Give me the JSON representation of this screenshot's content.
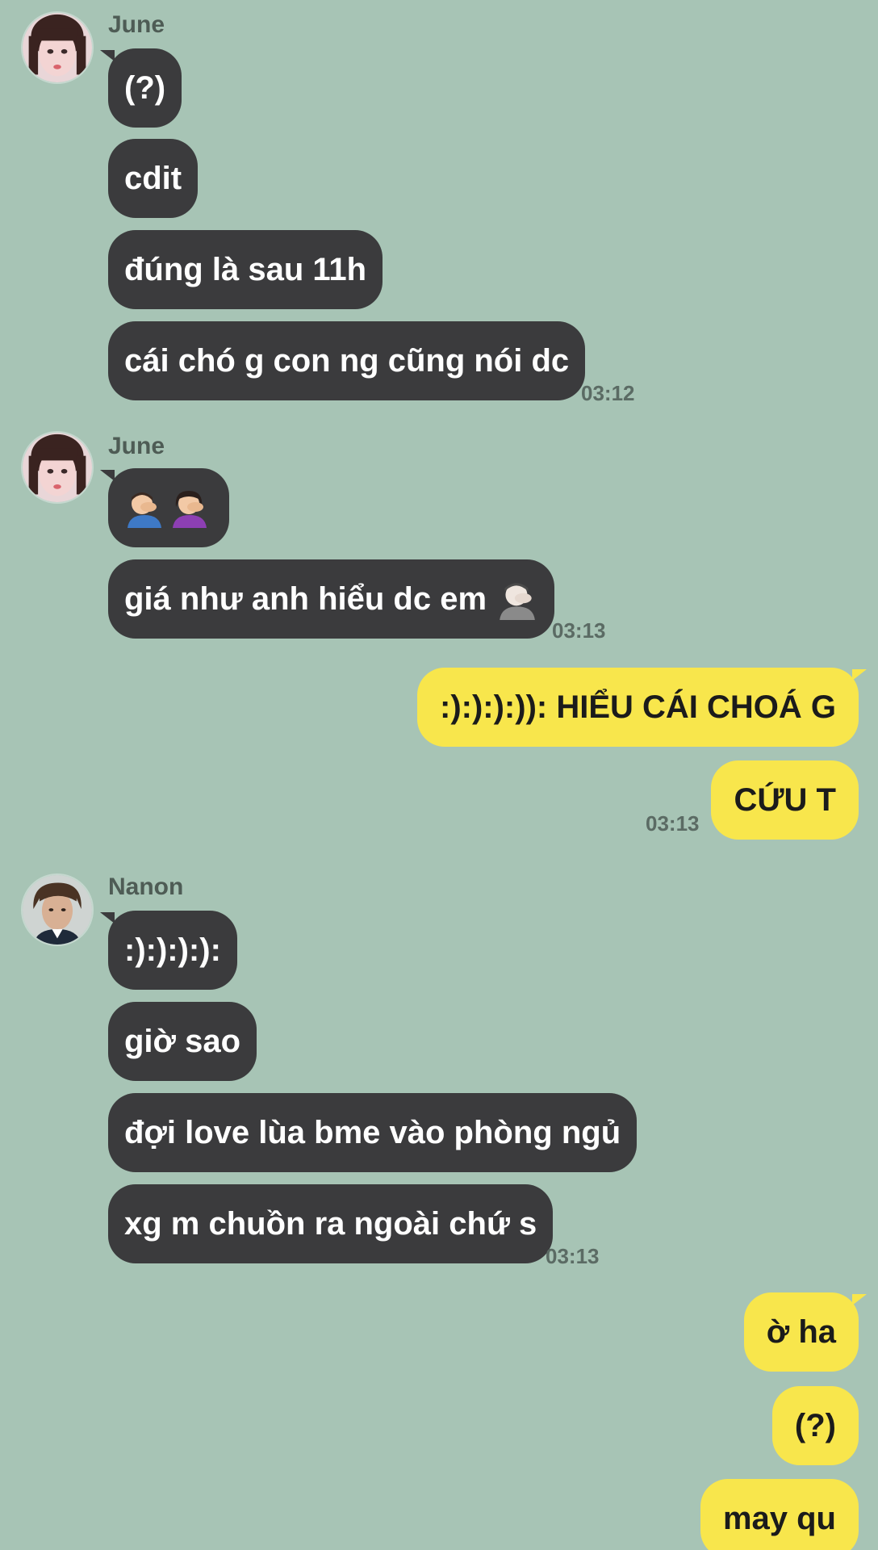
{
  "conversation": {
    "groups": [
      {
        "sender": "June",
        "messages": [
          "(?)",
          "cdit",
          "đúng là sau 11h",
          "cái chó g con ng cũng nói dc"
        ],
        "time": "03:12"
      },
      {
        "sender": "June",
        "messages": [
          "",
          "giá như anh hiểu dc em"
        ],
        "emojis": [
          "man-facepalming-emoji",
          "woman-facepalming-emoji",
          "person-facepalming-emoji"
        ],
        "time": "03:13"
      },
      {
        "sender": "me",
        "messages": [
          ":):):):)): HIỂU CÁI CHOÁ G",
          "CỨU T"
        ],
        "time": "03:13"
      },
      {
        "sender": "Nanon",
        "messages": [
          ":):):):):",
          "giờ sao",
          "đợi love lùa bme vào phòng ngủ",
          "xg m chuồn ra ngoài chứ s"
        ],
        "time": "03:13"
      },
      {
        "sender": "me",
        "messages": [
          "ờ ha",
          "(?)",
          "may qu"
        ]
      }
    ]
  },
  "colors": {
    "background": "#a7c4b5",
    "incoming_bubble": "#3b3b3d",
    "outgoing_bubble": "#f8e64c"
  }
}
